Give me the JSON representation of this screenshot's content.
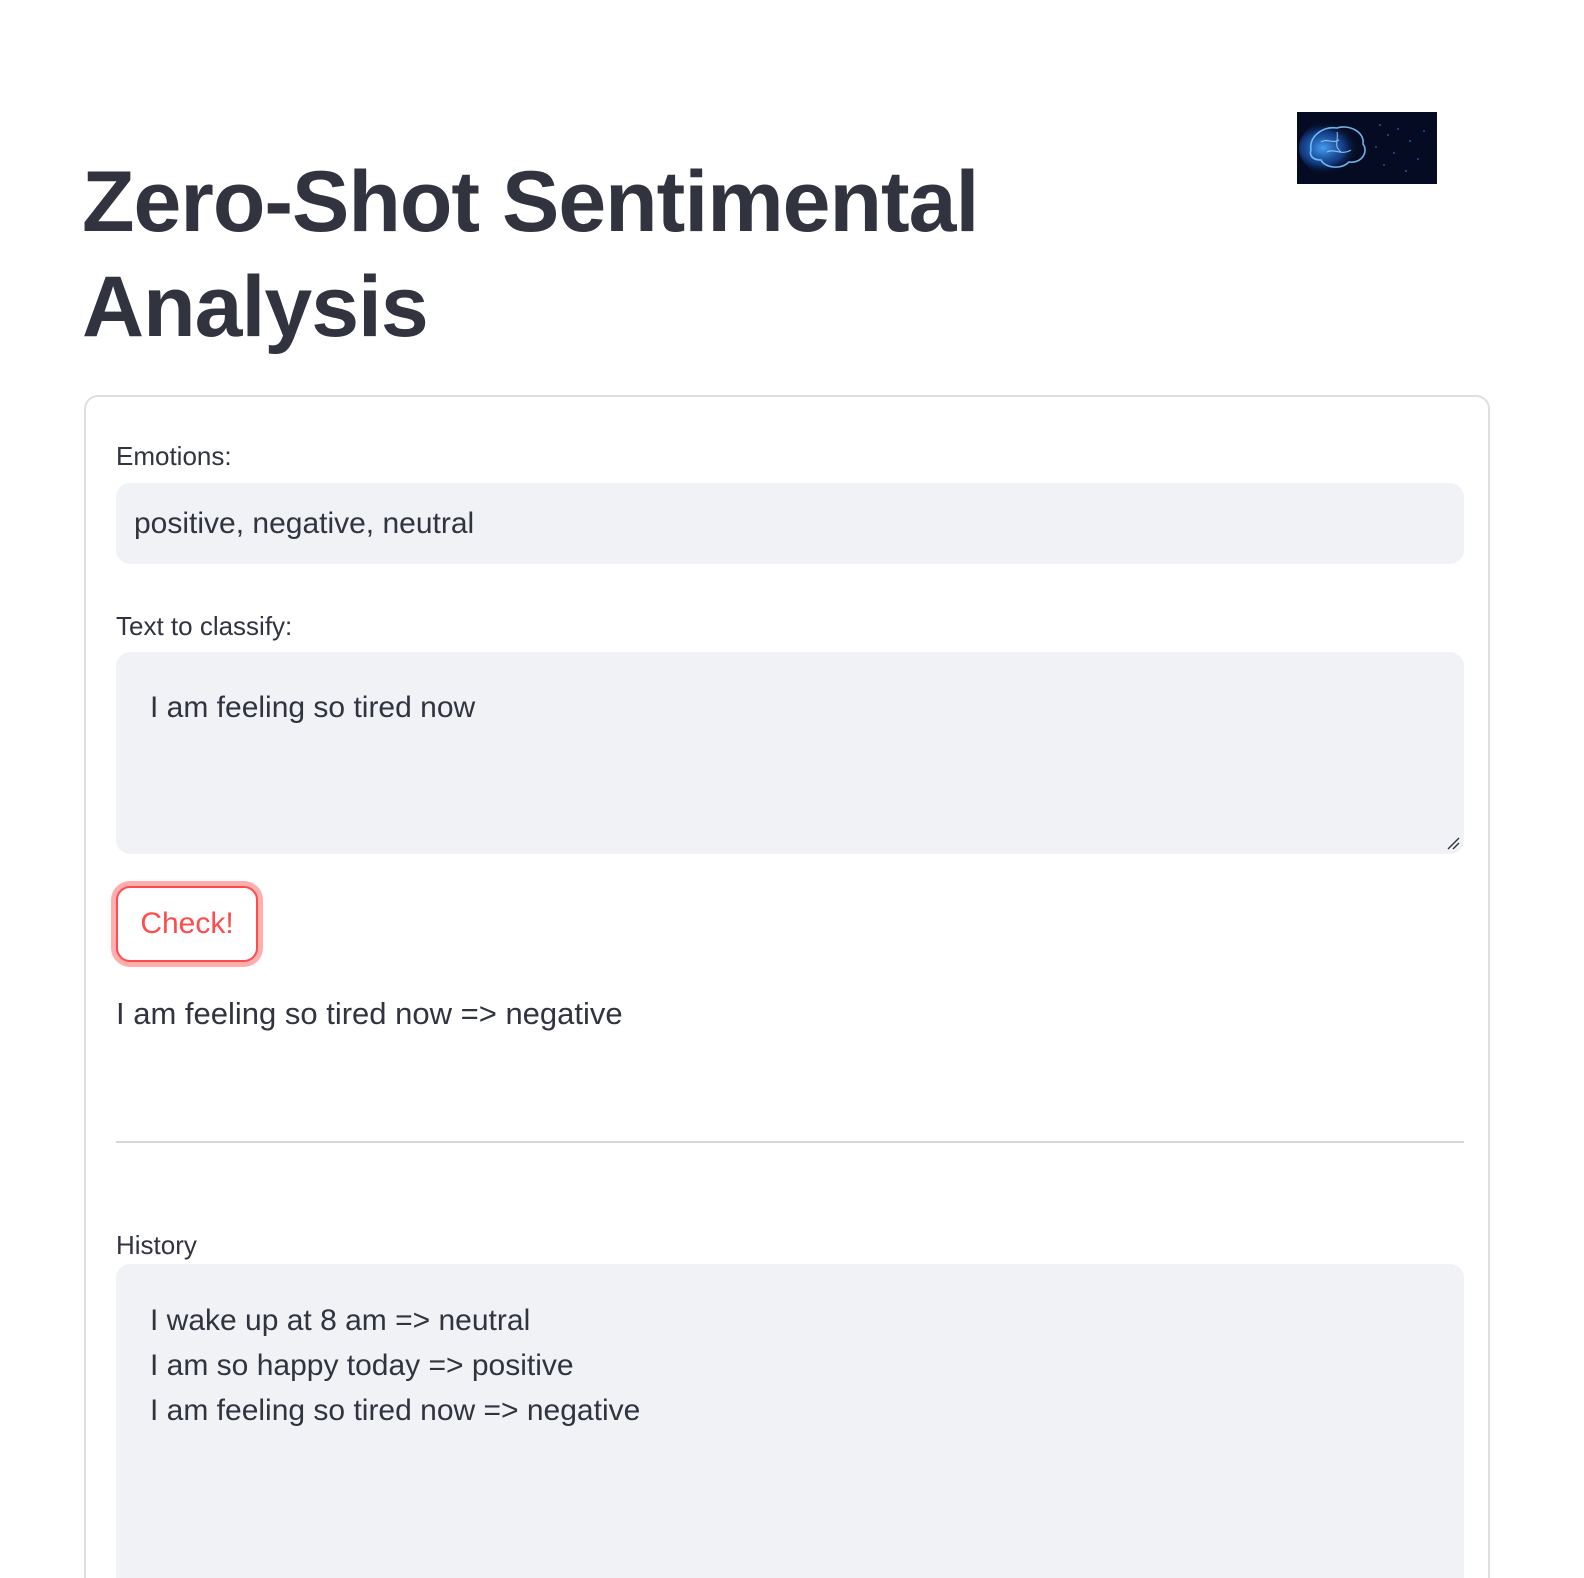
{
  "header": {
    "title": "Zero-Shot Sentimental Analysis",
    "logo_icon": "brain-icon"
  },
  "form": {
    "emotions_label": "Emotions:",
    "emotions_value": "positive, negative, neutral",
    "text_label": "Text to classify:",
    "text_value": "I am feeling so tired now",
    "check_button_label": "Check!",
    "result": "I am feeling so tired now => negative",
    "history_label": "History",
    "history_lines": [
      "I wake up at 8 am => neutral",
      "I am so happy today => positive",
      "I am feeling so tired now => negative"
    ]
  },
  "colors": {
    "accent": "#ff4b4b",
    "text": "#31333f",
    "input_background": "#f0f2f6"
  }
}
